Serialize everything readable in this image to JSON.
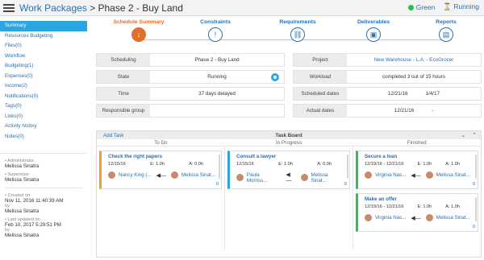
{
  "header": {
    "crumb1": "Work Packages",
    "sep": " > ",
    "crumb2": "Phase 2 - Buy Land",
    "health": "Green",
    "state": "Running"
  },
  "sidebar": {
    "items": [
      {
        "label": "Summary"
      },
      {
        "label": "Resources Budgeting"
      },
      {
        "label": "Files(0)"
      },
      {
        "label": "Workflow"
      },
      {
        "label": "Budgeting(1)"
      },
      {
        "label": "Expenses(0)"
      },
      {
        "label": "Income(2)"
      },
      {
        "label": "Notifications(0)"
      },
      {
        "label": "Tags(0)"
      },
      {
        "label": "Links(0)"
      },
      {
        "label": "Activity history"
      },
      {
        "label": "Notes(0)"
      }
    ],
    "administrator_label": "Administrator",
    "administrator": "Melissa Sinatra",
    "supervisor_label": "Supervisor",
    "supervisor": "Melissa Sinatra",
    "created_label": "Created on",
    "created": "Nov 11, 2016 11:40:39 AM",
    "created_by_label": "by",
    "created_by": "Melissa Sinatra",
    "updated_label": "Last updated on",
    "updated": "Feb 10, 2017 5:29:51 PM",
    "updated_by_label": "by",
    "updated_by": "Melissa Sinatra"
  },
  "steps": [
    {
      "label": "Schedule Summary",
      "icon": "download-arrow-icon",
      "glyph": "↓"
    },
    {
      "label": "Constraints",
      "icon": "exclamation-icon",
      "glyph": "!"
    },
    {
      "label": "Requirements",
      "icon": "link-icon",
      "glyph": "⛓"
    },
    {
      "label": "Deliverables",
      "icon": "briefcase-icon",
      "glyph": "▣"
    },
    {
      "label": "Reports",
      "icon": "clipboard-icon",
      "glyph": "▤"
    }
  ],
  "info": {
    "scheduling_label": "Scheduling",
    "scheduling": "Phase 2 - Buy Land",
    "project_label": "Project",
    "project": "New Warehouse - L.A. - EcoGrocer",
    "state_label": "State",
    "state": "Running",
    "workload_label": "Workload",
    "workload": "completed 3 out of 15 hours",
    "time_label": "Time",
    "time": "37 days delayed",
    "sched_dates_label": "Scheduled dates",
    "sched_start": "12/21/16",
    "sched_end": "1/4/17",
    "resp_label": "Responsible group",
    "resp": "",
    "actual_label": "Actual dates",
    "actual_start": "12/21/16",
    "actual_end": "-"
  },
  "board": {
    "add_label": "Add Task",
    "title": "Task Board",
    "columns": [
      "To Do",
      "In Progress",
      "Finished"
    ],
    "todo": [
      {
        "title": "Check the right papers",
        "date": "12/15/16",
        "est": "E: 1.0h",
        "act": "A: 0.0h",
        "assignee": "Nancy King (...",
        "owner": "Melissa Sinat...",
        "count": "0"
      }
    ],
    "progress": [
      {
        "title": "Consult a lawyer",
        "date": "12/15/16",
        "est": "E: 1.0h",
        "act": "A: 0.0h",
        "assignee": "Paula Morriss...",
        "owner": "Melissa Sinat...",
        "count": "0"
      }
    ],
    "finished": [
      {
        "title": "Secure a loan",
        "date": "12/19/16 - 12/21/16",
        "est": "E: 1.0h",
        "act": "A: 1.0h",
        "assignee": "Virginia Nas...",
        "owner": "Melissa Sinat...",
        "count": "0"
      },
      {
        "title": "Make an offer",
        "date": "12/19/16 - 12/21/16",
        "est": "E: 1.0h",
        "act": "A: 1.0h",
        "assignee": "Virginia Nas...",
        "owner": "Melissa Sinat...",
        "count": "0"
      }
    ]
  }
}
